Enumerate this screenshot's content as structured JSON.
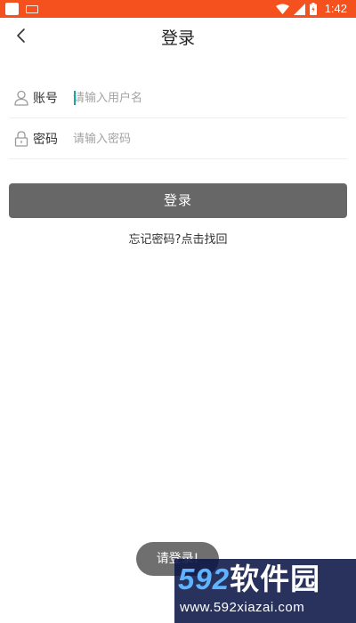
{
  "status_bar": {
    "time": "1:42",
    "background": "#f4511e"
  },
  "header": {
    "title": "登录",
    "back_icon": "chevron-left-icon"
  },
  "form": {
    "account": {
      "label": "账号",
      "placeholder": "请输入用户名",
      "value": "",
      "icon": "user-icon"
    },
    "password": {
      "label": "密码",
      "placeholder": "请输入密码",
      "value": "",
      "icon": "lock-icon"
    },
    "submit_label": "登录",
    "forgot_label": "忘记密码?点击找回"
  },
  "toast": {
    "text": "请登录!"
  },
  "watermark": {
    "logo_number": "592",
    "logo_text": "软件园",
    "url": "www.592xiazai.com"
  },
  "colors": {
    "accent": "#f4511e",
    "button": "#676767",
    "caret": "#1ea5a0"
  }
}
